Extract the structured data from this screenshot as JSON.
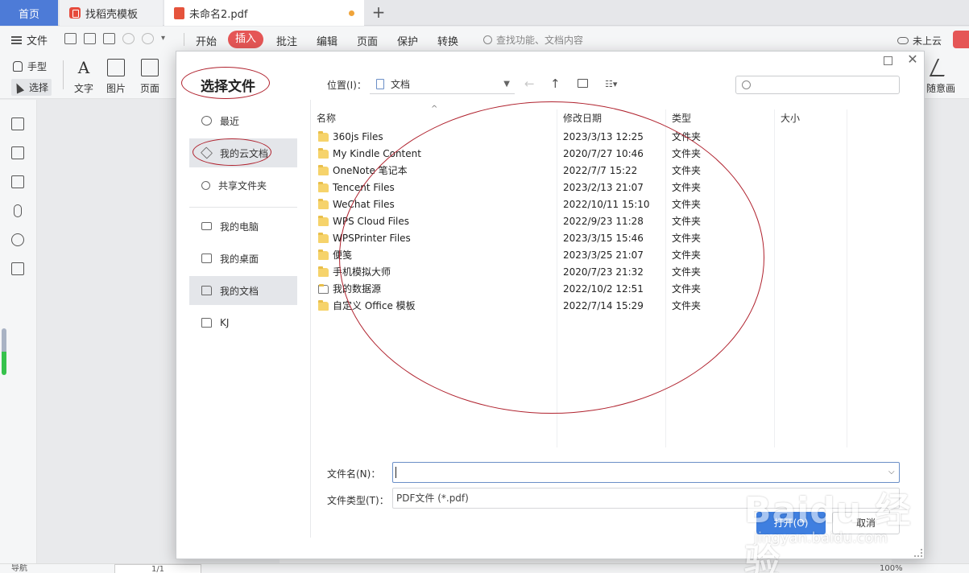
{
  "tabs": [
    {
      "label": "首页"
    },
    {
      "label": "找稻壳模板"
    },
    {
      "label": "未命名2.pdf"
    }
  ],
  "menubar": {
    "file": "文件",
    "items": [
      "开始",
      "插入",
      "批注",
      "编辑",
      "页面",
      "保护",
      "转换"
    ],
    "active": "插入",
    "search_placeholder": "查找功能、文档内容",
    "cloud_status": "未上云"
  },
  "toolbar": {
    "hand": "手型",
    "select": "选择",
    "text": "文字",
    "image": "图片",
    "page": "页面",
    "freehand": "随意画"
  },
  "status": {
    "nav_label": "导航",
    "page_indicator": "1/1",
    "zoom": "100%"
  },
  "dialog": {
    "title": "选择文件",
    "location_label": "位置(I)：",
    "location_value": "文档",
    "places": [
      {
        "label": "最近"
      },
      {
        "label": "我的云文档"
      },
      {
        "label": "共享文件夹"
      },
      {
        "label": "我的电脑"
      },
      {
        "label": "我的桌面"
      },
      {
        "label": "我的文档"
      },
      {
        "label": "KJ"
      }
    ],
    "columns": {
      "name": "名称",
      "date": "修改日期",
      "type": "类型",
      "size": "大小"
    },
    "files": [
      {
        "name": "360js Files",
        "date": "2023/3/13 12:25",
        "type": "文件夹"
      },
      {
        "name": "My Kindle Content",
        "date": "2020/7/27 10:46",
        "type": "文件夹"
      },
      {
        "name": "OneNote 笔记本",
        "date": "2022/7/7 15:22",
        "type": "文件夹"
      },
      {
        "name": "Tencent Files",
        "date": "2023/2/13 21:07",
        "type": "文件夹"
      },
      {
        "name": "WeChat Files",
        "date": "2022/10/11 15:10",
        "type": "文件夹"
      },
      {
        "name": "WPS Cloud Files",
        "date": "2022/9/23 11:28",
        "type": "文件夹"
      },
      {
        "name": "WPSPrinter Files",
        "date": "2023/3/15 15:46",
        "type": "文件夹"
      },
      {
        "name": "便笺",
        "date": "2023/3/25 21:07",
        "type": "文件夹"
      },
      {
        "name": "手机模拟大师",
        "date": "2020/7/23 21:32",
        "type": "文件夹"
      },
      {
        "name": "我的数据源",
        "date": "2022/10/2 12:51",
        "type": "文件夹"
      },
      {
        "name": "自定义 Office 模板",
        "date": "2022/7/14 15:29",
        "type": "文件夹"
      }
    ],
    "filename_label": "文件名(N)：",
    "filename_value": "",
    "filetype_label": "文件类型(T)：",
    "filetype_value": "PDF文件 (*.pdf)",
    "open_button": "打开(O)",
    "cancel_button": "取消"
  },
  "watermark": {
    "brand": "Baidu 经验",
    "url": "jingyan.baidu.com"
  },
  "colors": {
    "accent": "#e55656",
    "home_tab": "#4d7bd7",
    "open_button": "#3f7fe0",
    "annotation": "#b0222e"
  }
}
